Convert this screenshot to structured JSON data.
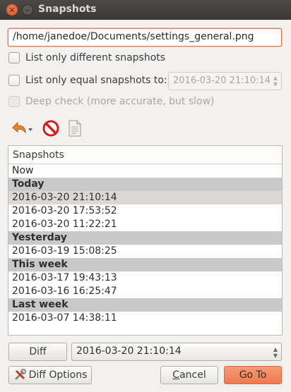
{
  "window": {
    "title": "Snapshots"
  },
  "path": {
    "value": "/home/janedoe/Documents/settings_general.png"
  },
  "options": {
    "different_label": "List only different snapshots",
    "equal_label": "List only equal snapshots to:",
    "equal_value": "2016-03-20 21:10:14",
    "deep_check_label": "Deep check (more accurate, but slow)"
  },
  "toolbar": {
    "icons": [
      "undo-restore-icon",
      "delete-icon",
      "file-icon"
    ]
  },
  "list": {
    "header": "Snapshots",
    "rows": [
      {
        "text": "Now",
        "type": "item"
      },
      {
        "text": "Today",
        "type": "group"
      },
      {
        "text": "2016-03-20 21:10:14",
        "type": "item",
        "selected": true
      },
      {
        "text": "2016-03-20 17:53:52",
        "type": "item"
      },
      {
        "text": "2016-03-20 11:22:21",
        "type": "item"
      },
      {
        "text": "Yesterday",
        "type": "group"
      },
      {
        "text": "2016-03-19 15:08:25",
        "type": "item"
      },
      {
        "text": "This week",
        "type": "group"
      },
      {
        "text": "2016-03-17 19:43:13",
        "type": "item"
      },
      {
        "text": "2016-03-16 16:25:47",
        "type": "item"
      },
      {
        "text": "Last week",
        "type": "group"
      },
      {
        "text": "2016-03-07 14:38:11",
        "type": "item"
      }
    ]
  },
  "diff": {
    "button": "Diff",
    "selected": "2016-03-20 21:10:14"
  },
  "buttons": {
    "diff_options": "Diff Options",
    "cancel_first": "C",
    "cancel_rest": "ancel",
    "goto": "Go To"
  },
  "colors": {
    "accent": "#ef7a4d",
    "titlebar": "#3b3a36",
    "group_row": "#c9c9c9"
  }
}
